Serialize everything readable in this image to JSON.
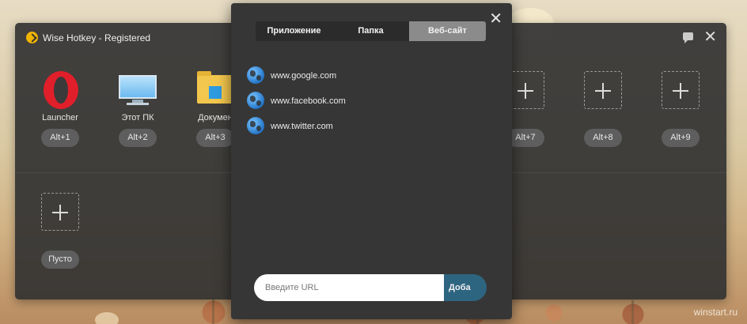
{
  "main": {
    "title": "Wise Hotkey - Registered",
    "slots_row1": [
      {
        "label": "Launcher",
        "hotkey": "Alt+1",
        "icon": "opera-icon"
      },
      {
        "label": "Этот ПК",
        "hotkey": "Alt+2",
        "icon": "monitor-icon"
      },
      {
        "label": "Докумен",
        "hotkey": "Alt+3",
        "icon": "folder-icon"
      },
      {
        "label": "",
        "hotkey": "Alt+7",
        "icon": "plus-icon"
      },
      {
        "label": "",
        "hotkey": "Alt+8",
        "icon": "plus-icon"
      },
      {
        "label": "",
        "hotkey": "Alt+9",
        "icon": "plus-icon"
      }
    ],
    "slots_row2": [
      {
        "label": "",
        "hotkey": "Пусто",
        "icon": "plus-icon"
      }
    ]
  },
  "popup": {
    "tabs": [
      {
        "label": "Приложение",
        "active": false
      },
      {
        "label": "Папка",
        "active": false
      },
      {
        "label": "Веб-сайт",
        "active": true
      }
    ],
    "urls": [
      "www.google.com",
      "www.facebook.com",
      "www.twitter.com"
    ],
    "url_input": {
      "value": "",
      "placeholder": "Введите URL"
    },
    "add_button": "Доба"
  },
  "watermark": "winstart.ru",
  "colors": {
    "accent": "#2d6581",
    "active_tab": "#8b8b8b",
    "logo": "#f0b400"
  }
}
